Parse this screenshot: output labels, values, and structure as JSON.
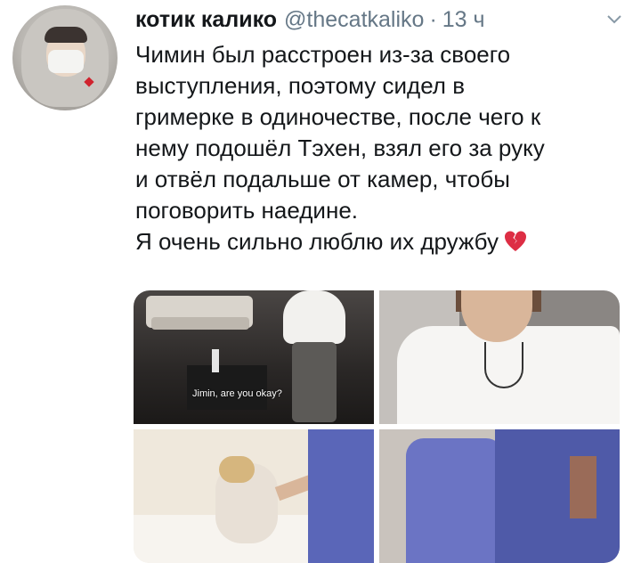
{
  "tweet": {
    "display_name": "котик калико",
    "handle": "@thecatkaliko",
    "separator": "·",
    "time": "13 ч",
    "text_lines": [
      "Чимин был расстроен из-за своего",
      "выступления, поэтому сидел в",
      "гримерке в одиночестве, после чего к",
      "нему подошёл Тэхен, взял его за руку",
      "и отвёл подальше от камер, чтобы",
      "поговорить наедине.",
      "Я очень сильно люблю их дружбу"
    ],
    "emoji": "broken-heart-icon",
    "media": {
      "subtitle": "Jimin, are you okay?"
    }
  },
  "colors": {
    "text": "#14171a",
    "secondary": "#657786",
    "broken_heart": "#dd2e44"
  }
}
